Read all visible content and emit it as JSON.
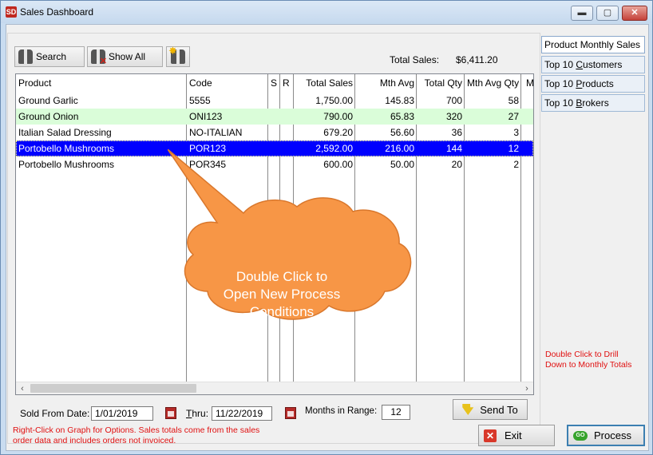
{
  "window": {
    "title": "Sales Dashboard",
    "app_icon": "SD"
  },
  "toolbar": {
    "search_label": "Search",
    "showall_label": "Show All"
  },
  "summary": {
    "total_label": "Total Sales:",
    "total_value": "$6,411.20"
  },
  "grid": {
    "columns": [
      "Product",
      "Code",
      "S",
      "R",
      "Total Sales",
      "Mth Avg",
      "Total Qty",
      "Mth Avg Qty",
      "M"
    ],
    "rows": [
      {
        "product": "Ground Garlic",
        "code": "5555",
        "s": "",
        "r": "",
        "total_sales": "1,750.00",
        "mth_avg": "145.83",
        "total_qty": "700",
        "mth_avg_qty": "58"
      },
      {
        "product": "Ground Onion",
        "code": "ONI123",
        "s": "",
        "r": "",
        "total_sales": "790.00",
        "mth_avg": "65.83",
        "total_qty": "320",
        "mth_avg_qty": "27"
      },
      {
        "product": "Italian Salad Dressing",
        "code": "NO-ITALIAN",
        "s": "",
        "r": "",
        "total_sales": "679.20",
        "mth_avg": "56.60",
        "total_qty": "36",
        "mth_avg_qty": "3"
      },
      {
        "product": "Portobello Mushrooms",
        "code": "POR123",
        "s": "",
        "r": "",
        "total_sales": "2,592.00",
        "mth_avg": "216.00",
        "total_qty": "144",
        "mth_avg_qty": "12"
      },
      {
        "product": "Portobello Mushrooms",
        "code": "POR345",
        "s": "",
        "r": "",
        "total_sales": "600.00",
        "mth_avg": "50.00",
        "total_qty": "20",
        "mth_avg_qty": "2"
      }
    ]
  },
  "callout": {
    "line1": "Double Click to",
    "line2": "Open New Process",
    "line3": "Conditions",
    "color": "#f79646"
  },
  "filters": {
    "sold_from_label": "Sold From Date:",
    "sold_from_value": "1/01/2019",
    "thru_label": "Thru:",
    "thru_value": "11/22/2019",
    "months_label": "Months in Range:",
    "months_value": "12"
  },
  "buttons": {
    "send_to": "Send To",
    "exit": "Exit",
    "process": "Process"
  },
  "notes": {
    "bottom_line1": "Right-Click on Graph for Options.  Sales totals come from the sales",
    "bottom_line2": "order data and includes orders not invoiced.",
    "right_line1": "Double Click to Drill",
    "right_line2": "Down to Monthly Totals"
  },
  "tabs": [
    "Product Monthly Sales",
    "Top 10 Customers",
    "Top 10 Products",
    "Top 10 Brokers"
  ]
}
